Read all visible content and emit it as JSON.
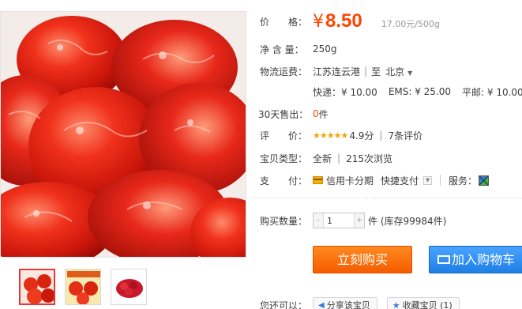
{
  "gallery": {
    "main_image": "dried-tomato-photo",
    "thumbnails": [
      {
        "name": "thumbnail-dried-tomatoes-package",
        "active": true
      },
      {
        "name": "thumbnail-dried-tomatoes-closeup",
        "active": false
      },
      {
        "name": "thumbnail-dried-tomatoes-pile",
        "active": false
      }
    ]
  },
  "price": {
    "label": "价　　格：",
    "currency": "¥",
    "amount": "8.50",
    "unit_price": "17.00元/500g"
  },
  "net_weight": {
    "label": "净 含 量：",
    "value": "250g"
  },
  "logistics": {
    "label": "物流运费：",
    "from": "江苏连云港",
    "to_word": "至",
    "to": "北京",
    "express": "快递：¥ 10.00",
    "ems": "EMS: ¥ 25.00",
    "surface": "平邮: ¥ 10.00"
  },
  "sold_30_days": {
    "label": "30天售出：",
    "count": "0",
    "unit": "件"
  },
  "rating": {
    "label": "评　　价：",
    "stars": "★★★★★",
    "score": "4.9分",
    "reviews": "7条评价"
  },
  "item_type": {
    "label": "宝贝类型：",
    "condition": "全新",
    "views": "215次浏览"
  },
  "payment": {
    "label": "支　　付：",
    "installment": "信用卡分期",
    "quick_pay": "快捷支付",
    "service_label": "服务："
  },
  "quantity": {
    "label": "购买数量：",
    "minus": "-",
    "value": "1",
    "plus": "+",
    "stock": "件 (库存99984件)"
  },
  "actions": {
    "buy_now": "立刻购买",
    "add_to_cart": "加入购物车"
  },
  "extras": {
    "label": "您还可以：",
    "share": "分享该宝贝",
    "favorite": "收藏宝贝 (1)"
  },
  "colors": {
    "accent_orange": "#ff4400",
    "buy_button": "#ff6a00",
    "cart_button": "#1e7fe6",
    "star": "#f7a400"
  }
}
